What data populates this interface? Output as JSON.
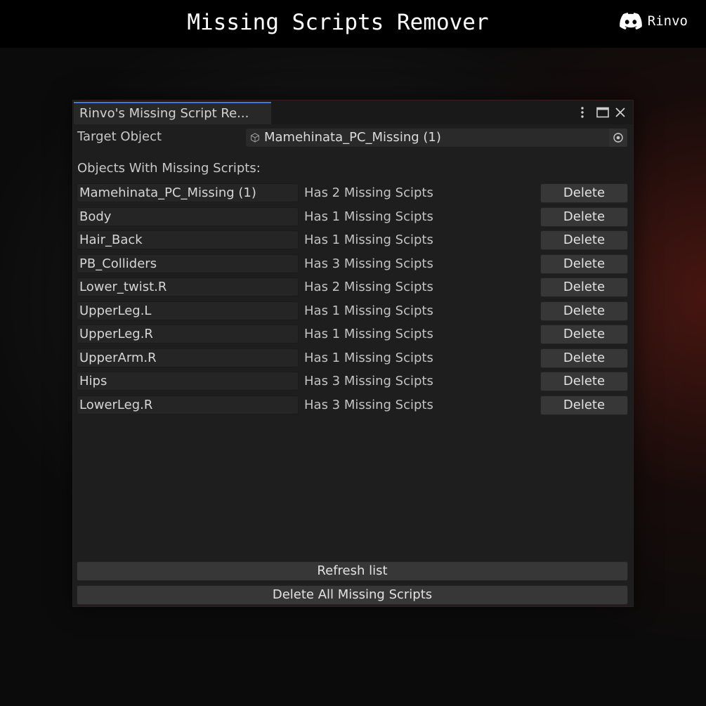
{
  "banner": {
    "title": "Missing Scripts Remover",
    "brand_name": "Rinvo",
    "brand_icon": "discord-icon"
  },
  "window": {
    "tab_title": "Rinvo's Missing Script Re...",
    "header_icons": [
      "more-vertical-icon",
      "maximize-icon",
      "close-icon"
    ],
    "target_label": "Target Object",
    "target_value": "Mamehinata_PC_Missing (1)",
    "target_icon": "cube-icon",
    "picker_icon": "object-picker-icon",
    "section_label": "Objects With Missing Scripts:",
    "rows": [
      {
        "name": "Mamehinata_PC_Missing (1)",
        "status": "Has 2 Missing Scipts",
        "action": "Delete"
      },
      {
        "name": "Body",
        "status": "Has 1 Missing Scipts",
        "action": "Delete"
      },
      {
        "name": "Hair_Back",
        "status": "Has 1 Missing Scipts",
        "action": "Delete"
      },
      {
        "name": "PB_Colliders",
        "status": "Has 3 Missing Scipts",
        "action": "Delete"
      },
      {
        "name": "Lower_twist.R",
        "status": "Has 2 Missing Scipts",
        "action": "Delete"
      },
      {
        "name": "UpperLeg.L",
        "status": "Has 1 Missing Scipts",
        "action": "Delete"
      },
      {
        "name": "UpperLeg.R",
        "status": "Has 1 Missing Scipts",
        "action": "Delete"
      },
      {
        "name": "UpperArm.R",
        "status": "Has 1 Missing Scipts",
        "action": "Delete"
      },
      {
        "name": "Hips",
        "status": "Has 3 Missing Scipts",
        "action": "Delete"
      },
      {
        "name": "LowerLeg.R",
        "status": "Has 3 Missing Scipts",
        "action": "Delete"
      }
    ],
    "refresh_label": "Refresh list",
    "delete_all_label": "Delete All Missing Scripts"
  },
  "colors": {
    "accent_tab": "#3d7bd5",
    "panel_bg": "#1e1e1e",
    "button_bg": "#373737"
  }
}
